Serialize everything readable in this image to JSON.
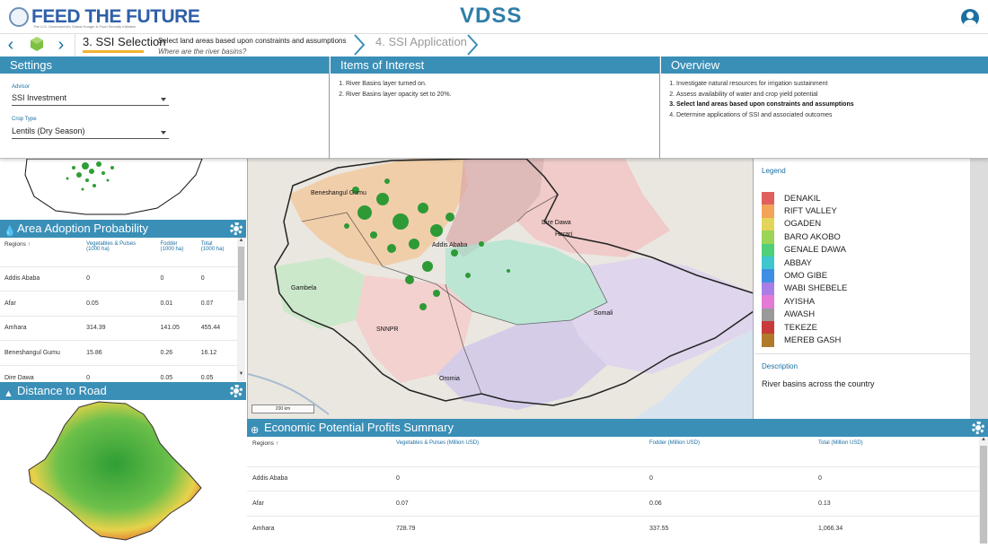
{
  "header": {
    "brand": "FEED THE FUTURE",
    "brand_sub": "The U.S. Government's Global Hunger & Food Security Initiative",
    "app_logo": "VDSS",
    "user_icon": "account-circle-icon"
  },
  "stepper": {
    "current_step": "3. SSI Selection",
    "current_desc": "Select land areas based upon constraints and assumptions",
    "current_question": "Where are the river basins?",
    "next_step": "4. SSI Application",
    "progress_color": "#f1b434"
  },
  "settings": {
    "title": "Settings",
    "advisor_label": "Advisor",
    "advisor_value": "SSI Investment",
    "crop_label": "Crop Type",
    "crop_value": "Lentils (Dry Season)"
  },
  "items": {
    "title": "Items of Interest",
    "list": [
      "River Basins layer turned on.",
      "River Basins layer opacity set to 20%."
    ]
  },
  "overview": {
    "title": "Overview",
    "list": [
      "Investigate natural resources for irrigation sustainment",
      "Assess availability of water and crop yield potential",
      "Select land areas based upon constraints and assumptions",
      "Determine applications of SSI and associated outcomes"
    ],
    "active_index": 2
  },
  "adoption": {
    "title": "Area Adoption Probability",
    "columns": [
      "Regions",
      "Vegetables & Pulses (1000 ha)",
      "Fodder (1000 ha)",
      "Total (1000 ha)"
    ],
    "col_parts": [
      [
        "Vegetables & Pulses",
        "(1000 ha)"
      ],
      [
        "Fodder",
        "(1000 ha)"
      ],
      [
        "Total",
        "(1000 ha)"
      ]
    ],
    "rows": [
      [
        "Addis Ababa",
        "0",
        "0",
        "0"
      ],
      [
        "Afar",
        "0.05",
        "0.01",
        "0.07"
      ],
      [
        "Amhara",
        "314.39",
        "141.05",
        "455.44"
      ],
      [
        "Beneshangul Gumu",
        "15.86",
        "0.26",
        "16.12"
      ],
      [
        "Dire Dawa",
        "0",
        "0.05",
        "0.05"
      ]
    ]
  },
  "distance": {
    "title": "Distance to Road"
  },
  "map": {
    "labels": [
      "Beneshangul Gumu",
      "Dire Dawa",
      "Harari",
      "Addis Ababa",
      "Gambela",
      "Somali",
      "SNNPR",
      "Oromia"
    ],
    "scale": "200 km"
  },
  "legend": {
    "title": "Legend",
    "items": [
      {
        "name": "DENAKIL",
        "color": "#e0605e"
      },
      {
        "name": "RIFT VALLEY",
        "color": "#f2a55a"
      },
      {
        "name": "OGADEN",
        "color": "#e3d55a"
      },
      {
        "name": "BARO AKOBO",
        "color": "#9bd456"
      },
      {
        "name": "GENALE DAWA",
        "color": "#4fcf7a"
      },
      {
        "name": "ABBAY",
        "color": "#3fc7cf"
      },
      {
        "name": "OMO GIBE",
        "color": "#3d8fe3"
      },
      {
        "name": "WABI SHEBELE",
        "color": "#a97ee6"
      },
      {
        "name": "AYISHA",
        "color": "#e27ad6"
      },
      {
        "name": "AWASH",
        "color": "#9a9a9a"
      },
      {
        "name": "TEKEZE",
        "color": "#c93a3a"
      },
      {
        "name": "MEREB GASH",
        "color": "#b07a2a"
      }
    ],
    "desc_title": "Description",
    "desc_text": "River basins across the country"
  },
  "economic": {
    "title": "Economic Potential Profits Summary",
    "columns": [
      "Regions",
      "Vegetables & Pulses (Million USD)",
      "Fodder (Million USD)",
      "Total (Million USD)"
    ],
    "rows": [
      [
        "Addis Ababa",
        "0",
        "0",
        "0"
      ],
      [
        "Afar",
        "0.07",
        "0.06",
        "0.13"
      ],
      [
        "Amhara",
        "728.79",
        "337.55",
        "1,066.34"
      ]
    ]
  }
}
